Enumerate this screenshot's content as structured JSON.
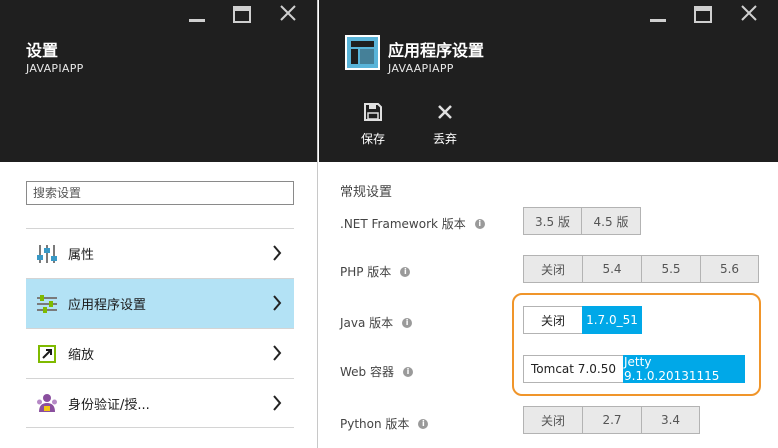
{
  "left_blade": {
    "title": "设置",
    "subtitle": "JAVAPIAPP",
    "search_placeholder": "搜索设置",
    "items": [
      {
        "label": "属性",
        "icon": "properties-icon"
      },
      {
        "label": "应用程序设置",
        "icon": "app-settings-icon",
        "selected": true
      },
      {
        "label": "缩放",
        "icon": "scale-icon"
      },
      {
        "label": "身份验证/授...",
        "icon": "auth-icon"
      }
    ]
  },
  "right_blade": {
    "title": "应用程序设置",
    "subtitle": "JAVAAPIAPP",
    "commands": {
      "save": "保存",
      "discard": "丢弃"
    },
    "section_title": "常规设置",
    "settings": {
      "net": {
        "label": ".NET Framework 版本",
        "options": [
          "3.5 版",
          "4.5 版"
        ]
      },
      "php": {
        "label": "PHP 版本",
        "options": [
          "关闭",
          "5.4",
          "5.5",
          "5.6"
        ]
      },
      "java": {
        "label": "Java 版本",
        "options": [
          "关闭",
          "1.7.0_51"
        ],
        "selected": "1.7.0_51"
      },
      "web": {
        "label": "Web 容器",
        "options": [
          "Tomcat 7.0.50",
          "Jetty 9.1.0.20131115"
        ],
        "selected": "Jetty 9.1.0.20131115"
      },
      "python": {
        "label": "Python 版本",
        "options": [
          "关闭",
          "2.7",
          "3.4"
        ]
      }
    }
  },
  "colors": {
    "header_bg": "#1f1f1f",
    "selected_nav": "#b3e2f5",
    "selected_option": "#00a8e8",
    "highlight": "#f0952a"
  }
}
